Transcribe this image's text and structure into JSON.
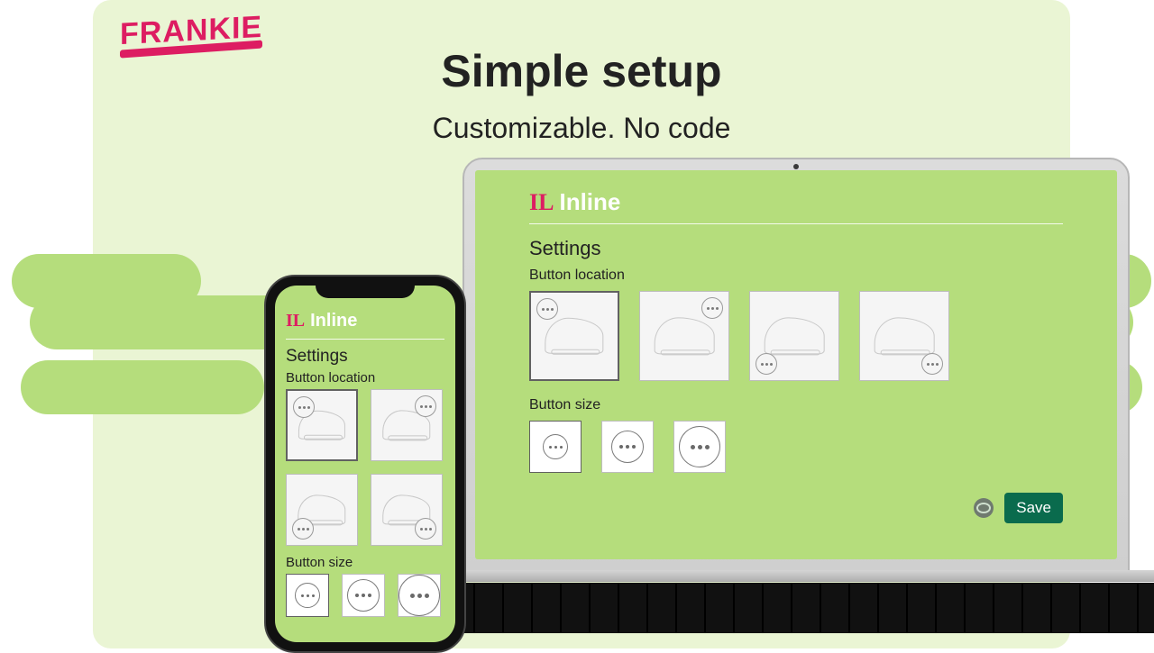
{
  "brand": "FRANKIE",
  "title": "Simple setup",
  "subtitle": "Customizable. No code",
  "app": {
    "mark": "IL",
    "name": "Inline",
    "settings_label": "Settings",
    "button_location_label": "Button location",
    "button_size_label": "Button size",
    "save_label": "Save",
    "location_options": [
      "top-left",
      "top-right",
      "bottom-left",
      "bottom-right"
    ],
    "size_options": [
      "small",
      "medium",
      "large"
    ]
  }
}
